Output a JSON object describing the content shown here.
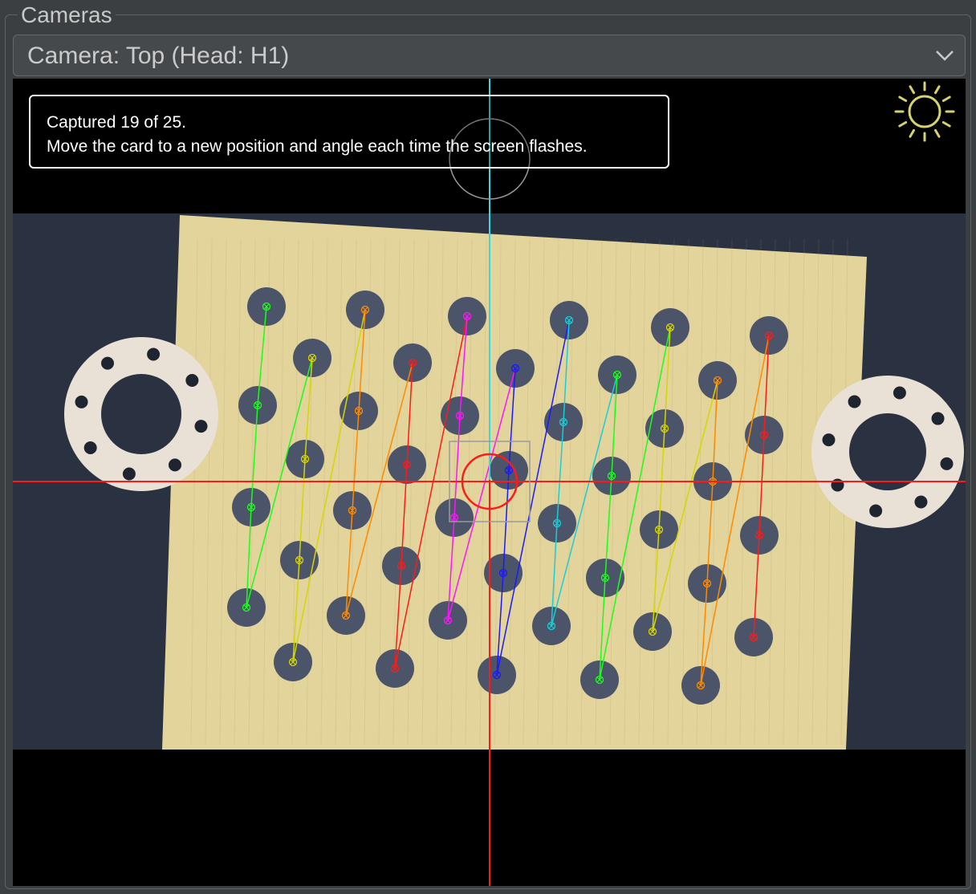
{
  "panel": {
    "title": "Cameras"
  },
  "camera_select": {
    "label": "Camera: Top (Head: H1)",
    "icon": "chevron-down-icon"
  },
  "status": {
    "line1": "Captured 19 of 25.",
    "line2": "Move the card to a new position and angle each time the screen flashes."
  },
  "toolbar": {
    "light_icon": "sun-icon",
    "light_color": "#d7d36a"
  },
  "colors": {
    "background": "#3c3f41",
    "reticle_vertical_top": "#35d8dc",
    "reticle_red": "#ff1a1a",
    "card": "#e2d49a",
    "pattern_lines": [
      "#1aff1a",
      "#d6d600",
      "#ff8a00",
      "#ff1a1a",
      "#ff14ff",
      "#1a1aff",
      "#18cfd6",
      "#1aff1a",
      "#d6d600",
      "#ff8a00",
      "#ff1a1a"
    ]
  }
}
